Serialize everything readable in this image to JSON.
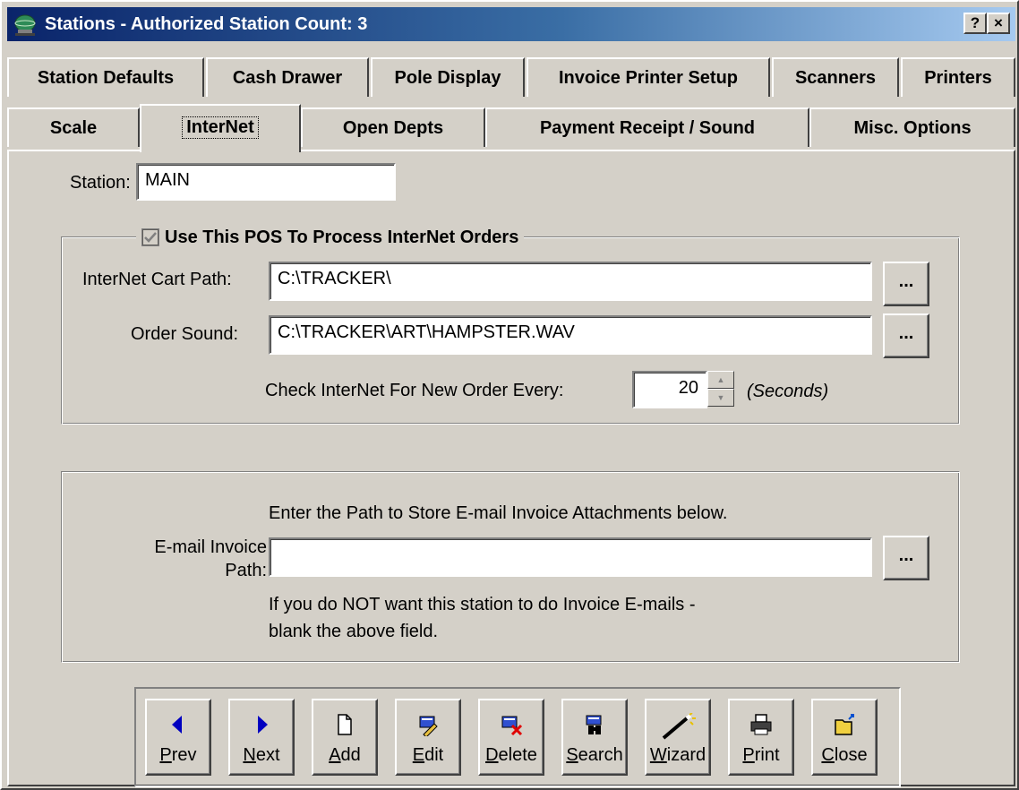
{
  "window": {
    "title": "Stations - Authorized Station Count: 3",
    "help_button": "?",
    "close_button": "×"
  },
  "tabs_row1": [
    "Station Defaults",
    "Cash Drawer",
    "Pole Display",
    "Invoice Printer Setup",
    "Scanners",
    "Printers"
  ],
  "tabs_row2": [
    "Scale",
    "InterNet",
    "Open Depts",
    "Payment Receipt / Sound",
    "Misc. Options"
  ],
  "active_tab": "InterNet",
  "station": {
    "label": "Station:",
    "value": "MAIN"
  },
  "internet_group": {
    "checkbox_label": "Use This POS To Process InterNet Orders",
    "checked": true,
    "cart_path_label": "InterNet Cart Path:",
    "cart_path_value": "C:\\TRACKER\\",
    "order_sound_label": "Order Sound:",
    "order_sound_value": "C:\\TRACKER\\ART\\HAMPSTER.WAV",
    "browse_label": "...",
    "check_every_label": "Check InterNet For New Order Every:",
    "check_every_value": "20",
    "seconds_label": "(Seconds)"
  },
  "email_group": {
    "instruction": "Enter the Path to Store E-mail Invoice Attachments below.",
    "path_label_line1": "E-mail Invoice",
    "path_label_line2": "Path:",
    "path_value": "",
    "browse_label": "...",
    "note_line1": "If you do NOT want this station to do Invoice E-mails -",
    "note_line2": "blank the above field."
  },
  "toolbar": {
    "buttons": [
      {
        "label": "Prev",
        "icon": "prev-arrow-icon"
      },
      {
        "label": "Next",
        "icon": "next-arrow-icon"
      },
      {
        "label": "Add",
        "icon": "new-document-icon"
      },
      {
        "label": "Edit",
        "icon": "edit-pencil-icon"
      },
      {
        "label": "Delete",
        "icon": "delete-record-icon"
      },
      {
        "label": "Search",
        "icon": "binoculars-icon"
      },
      {
        "label": "Wizard",
        "icon": "magic-wand-icon"
      },
      {
        "label": "Print",
        "icon": "printer-icon"
      },
      {
        "label": "Close",
        "icon": "close-folder-icon"
      }
    ]
  },
  "colors": {
    "face": "#d4d0c8",
    "title_gradient_start": "#0a246a",
    "title_gradient_end": "#a6caf0",
    "arrow_blue": "#0000c0"
  }
}
